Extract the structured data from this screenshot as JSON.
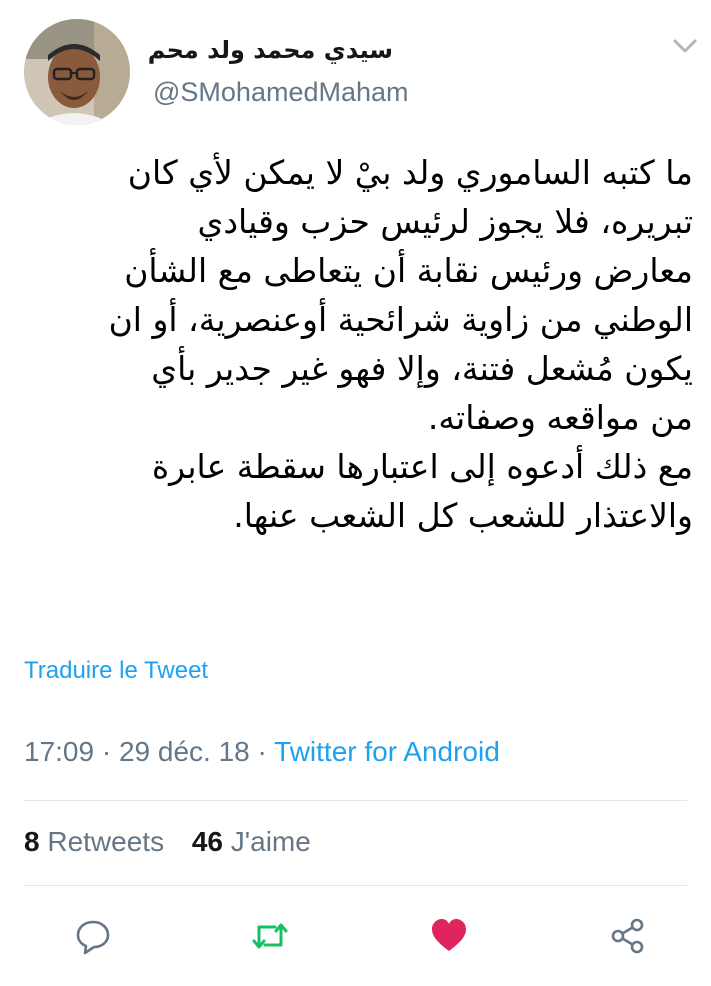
{
  "user": {
    "display_name": "سيدي محمد ولد محم",
    "handle": "@SMohamedMaham"
  },
  "tweet": {
    "lines": [
      "ما كتبه الساموري ولد بيْ لا يمكن لأي كان",
      "تبريره، فلا يجوز لرئيس حزب وقيادي",
      "معارض ورئيس نقابة أن يتعاطى مع الشأن",
      "الوطني من زاوية شرائحية أوعنصرية، أو ان",
      "يكون مُشعل فتنة، وإلا فهو غير جدير بأي",
      "من مواقعه وصفاته.",
      "مع ذلك أدعوه إلى اعتبارها سقطة عابرة",
      "والاعتذار للشعب كل الشعب عنها."
    ],
    "translate_label": "Traduire le Tweet",
    "time": "17:09",
    "date": "29 déc. 18",
    "separator": "·",
    "source": "Twitter for Android"
  },
  "stats": {
    "retweets_count": "8",
    "retweets_label": "Retweets",
    "likes_count": "46",
    "likes_label": "J'aime"
  },
  "actions": {
    "reply_icon": "reply-icon",
    "retweet_icon": "retweet-icon",
    "like_icon": "heart-icon",
    "share_icon": "share-icon"
  },
  "colors": {
    "link_blue": "#1da1f2",
    "secondary_gray": "#657786",
    "retweet_green": "#17bf63",
    "like_red": "#e0245e"
  }
}
